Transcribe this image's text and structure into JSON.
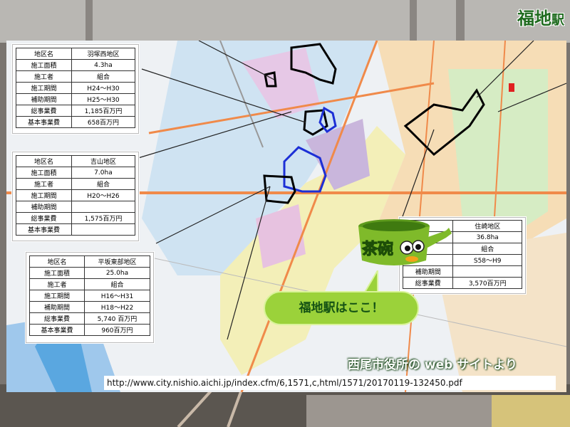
{
  "slide": {
    "station_title": "福地",
    "station_title_suffix": "駅",
    "credit": "西尾市役所の web サイトより",
    "url": "http://www.city.nishio.aichi.jp/index.cfm/6,1571,c,html/1571/20170119-132450.pdf",
    "bubble": "福地駅はここ！",
    "mascot_text": "茶碗"
  },
  "tables": {
    "hanetsuka": [
      [
        "地区名",
        "羽塚西地区"
      ],
      [
        "施工面積",
        "4.3ha"
      ],
      [
        "施工者",
        "組合"
      ],
      [
        "施工期間",
        "H24～H30"
      ],
      [
        "補助期間",
        "H25～H30"
      ],
      [
        "総事業費",
        "1,185百万円"
      ],
      [
        "基本事業費",
        "658百万円"
      ]
    ],
    "yoshiyama": [
      [
        "地区名",
        "吉山地区"
      ],
      [
        "施工面積",
        "7.0ha"
      ],
      [
        "施工者",
        "組合"
      ],
      [
        "施工期間",
        "H20～H26"
      ],
      [
        "補助期間",
        ""
      ],
      [
        "総事業費",
        "1,575百万円"
      ],
      [
        "基本事業費",
        ""
      ]
    ],
    "hirasaka": [
      [
        "地区名",
        "平坂東部地区"
      ],
      [
        "施工面積",
        "25.0ha"
      ],
      [
        "施工者",
        "組合"
      ],
      [
        "施工期間",
        "H16～H31"
      ],
      [
        "補助期間",
        "H18～H22"
      ],
      [
        "総事業費",
        "5,740 百万円"
      ],
      [
        "基本事業費",
        "960百万円"
      ]
    ],
    "sumizaki": [
      [
        "",
        "住崎地区"
      ],
      [
        "",
        "36.8ha"
      ],
      [
        "",
        "組合"
      ],
      [
        "",
        "S58～H9"
      ],
      [
        "補助期間",
        ""
      ],
      [
        "総事業費",
        "3,570百万円"
      ],
      [
        "基本事業費",
        ""
      ]
    ]
  },
  "colors": {
    "accent_green": "#1f6b1f",
    "bubble_green": "#9bd23a",
    "mascot_green": "#7fba2a"
  }
}
